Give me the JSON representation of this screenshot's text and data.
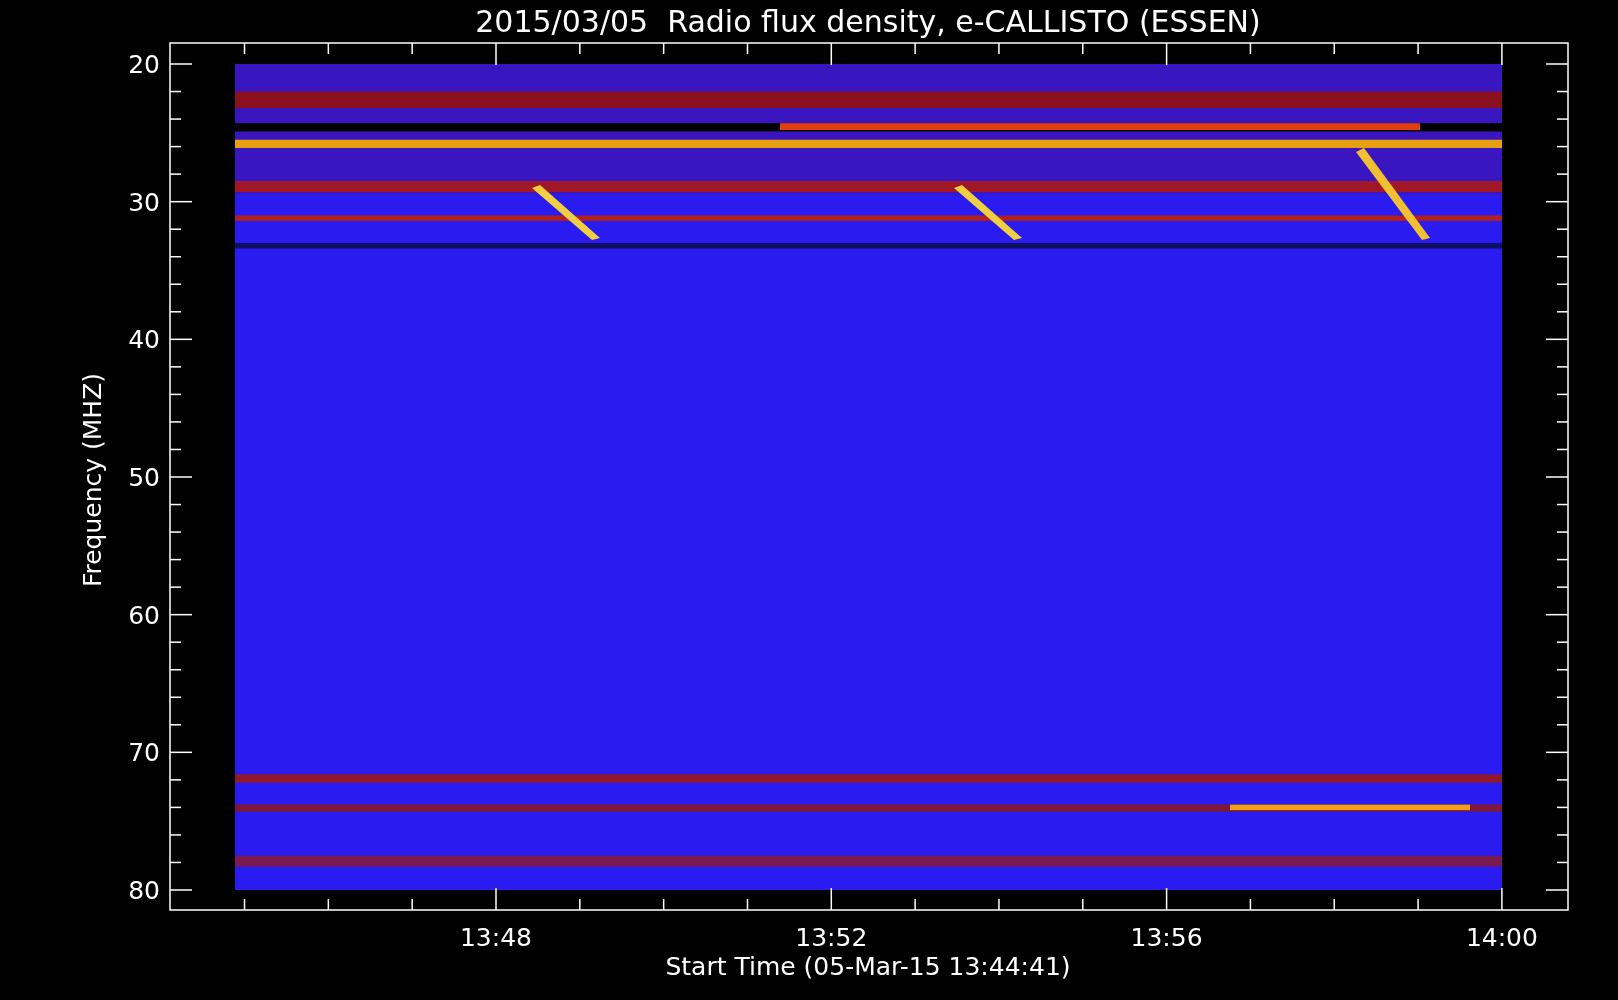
{
  "plot": {
    "title": "2015/03/05  Radio flux density, e-CALLISTO (ESSEN)",
    "ylabel": "Frequency (MHZ)",
    "xlabel": "Start Time (05-Mar-15 13:44:41)",
    "y_tick_labels": [
      "20",
      "30",
      "40",
      "50",
      "60",
      "70",
      "80"
    ],
    "x_tick_labels": [
      "13:48",
      "13:52",
      "13:56",
      "14:00"
    ]
  }
}
